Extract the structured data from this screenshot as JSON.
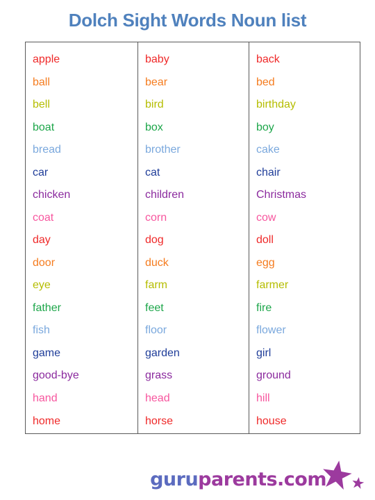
{
  "page": {
    "title": "Dolch Sight Words Noun list"
  },
  "table": {
    "row_colors": [
      "#ef2929",
      "#f57c1f",
      "#b5bd00",
      "#1da64a",
      "#7aa8dd",
      "#1f3d99",
      "#8b2a9e",
      "#f7569e"
    ],
    "border_color": "#595959",
    "columns": [
      {
        "name": "column-1",
        "words": [
          "apple",
          "ball",
          "bell",
          "boat",
          "bread",
          "car",
          "chicken",
          "coat",
          "day",
          "door",
          "eye",
          "father",
          "fish",
          "game",
          "good-bye",
          "hand",
          "home"
        ]
      },
      {
        "name": "column-2",
        "words": [
          "baby",
          "bear",
          "bird",
          "box",
          "brother",
          "cat",
          "children",
          "corn",
          "dog",
          "duck",
          "farm",
          "feet",
          "floor",
          "garden",
          "grass",
          "head",
          "horse"
        ]
      },
      {
        "name": "column-3",
        "words": [
          "back",
          "bed",
          "birthday",
          "boy",
          "cake",
          "chair",
          "Christmas",
          "cow",
          "doll",
          "egg",
          "farmer",
          "fire",
          "flower",
          "girl",
          "ground",
          "hill",
          "house"
        ]
      }
    ]
  },
  "footer": {
    "logo_guru": "guru",
    "logo_parents": "parents.com",
    "logo_guru_color": "#5b6bbf",
    "logo_parents_color": "#9c3a9e",
    "star_color": "#9c3a9e"
  },
  "theme": {
    "title_color": "#4f81bd",
    "background": "#ffffff"
  }
}
